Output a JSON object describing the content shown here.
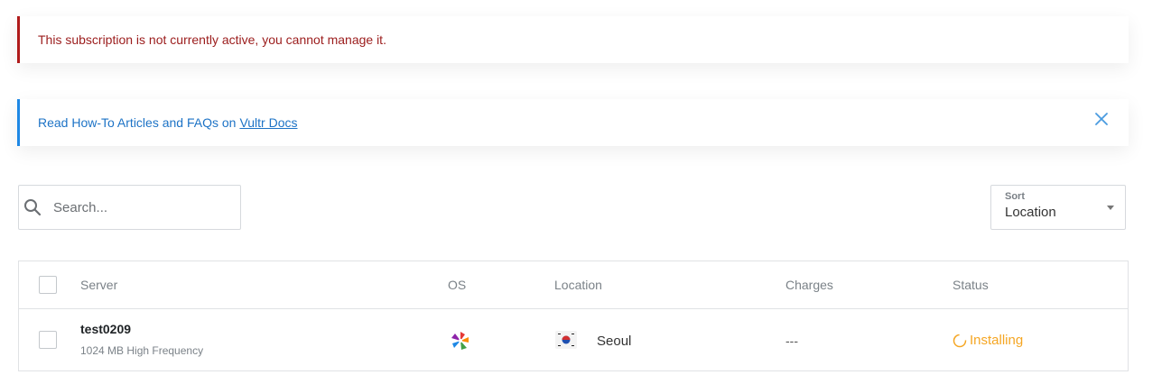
{
  "alerts": {
    "error_text": "This subscription is not currently active, you cannot manage it.",
    "info_text": "Read How-To Articles and FAQs on",
    "info_link": "Vultr Docs",
    "close_icon": "close-icon"
  },
  "search": {
    "placeholder": "Search...",
    "value": "",
    "icon": "search-icon"
  },
  "sort": {
    "label": "Sort",
    "value": "Location"
  },
  "table": {
    "columns": [
      "Server",
      "OS",
      "Location",
      "Charges",
      "Status"
    ],
    "rows": [
      {
        "name": "test0209",
        "plan": "1024 MB High Frequency",
        "os_icon": "pinwheel-os-icon",
        "flag_icon": "south-korea-flag-icon",
        "location": "Seoul",
        "charges": "---",
        "status": "Installing"
      }
    ]
  },
  "colors": {
    "error": "#9b1c1c",
    "info": "#1d73c6",
    "status_installing": "#f5a623"
  }
}
